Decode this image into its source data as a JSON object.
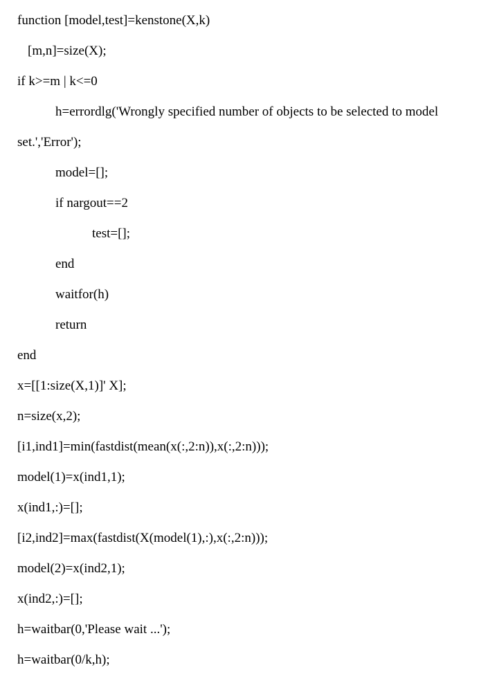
{
  "code": {
    "l1": "function [model,test]=kenstone(X,k)",
    "l2": "[m,n]=size(X);",
    "l3": "if k>=m | k<=0",
    "l4": "h=errordlg('Wrongly specified number of objects to be selected to model",
    "l5": "set.','Error');",
    "l6": "model=[];",
    "l7": "if nargout==2",
    "l8": "test=[];",
    "l9": "end",
    "l10": "waitfor(h)",
    "l11": "return",
    "l12": "end",
    "l13": "x=[[1:size(X,1)]' X];",
    "l14": "n=size(x,2);",
    "l15": "[i1,ind1]=min(fastdist(mean(x(:,2:n)),x(:,2:n)));",
    "l16": "model(1)=x(ind1,1);",
    "l17": "x(ind1,:)=[];",
    "l18": "[i2,ind2]=max(fastdist(X(model(1),:),x(:,2:n)));",
    "l19": "model(2)=x(ind2,1);",
    "l20": "x(ind2,:)=[];",
    "l21": "h=waitbar(0,'Please wait ...');",
    "l22": "h=waitbar(0/k,h);"
  }
}
